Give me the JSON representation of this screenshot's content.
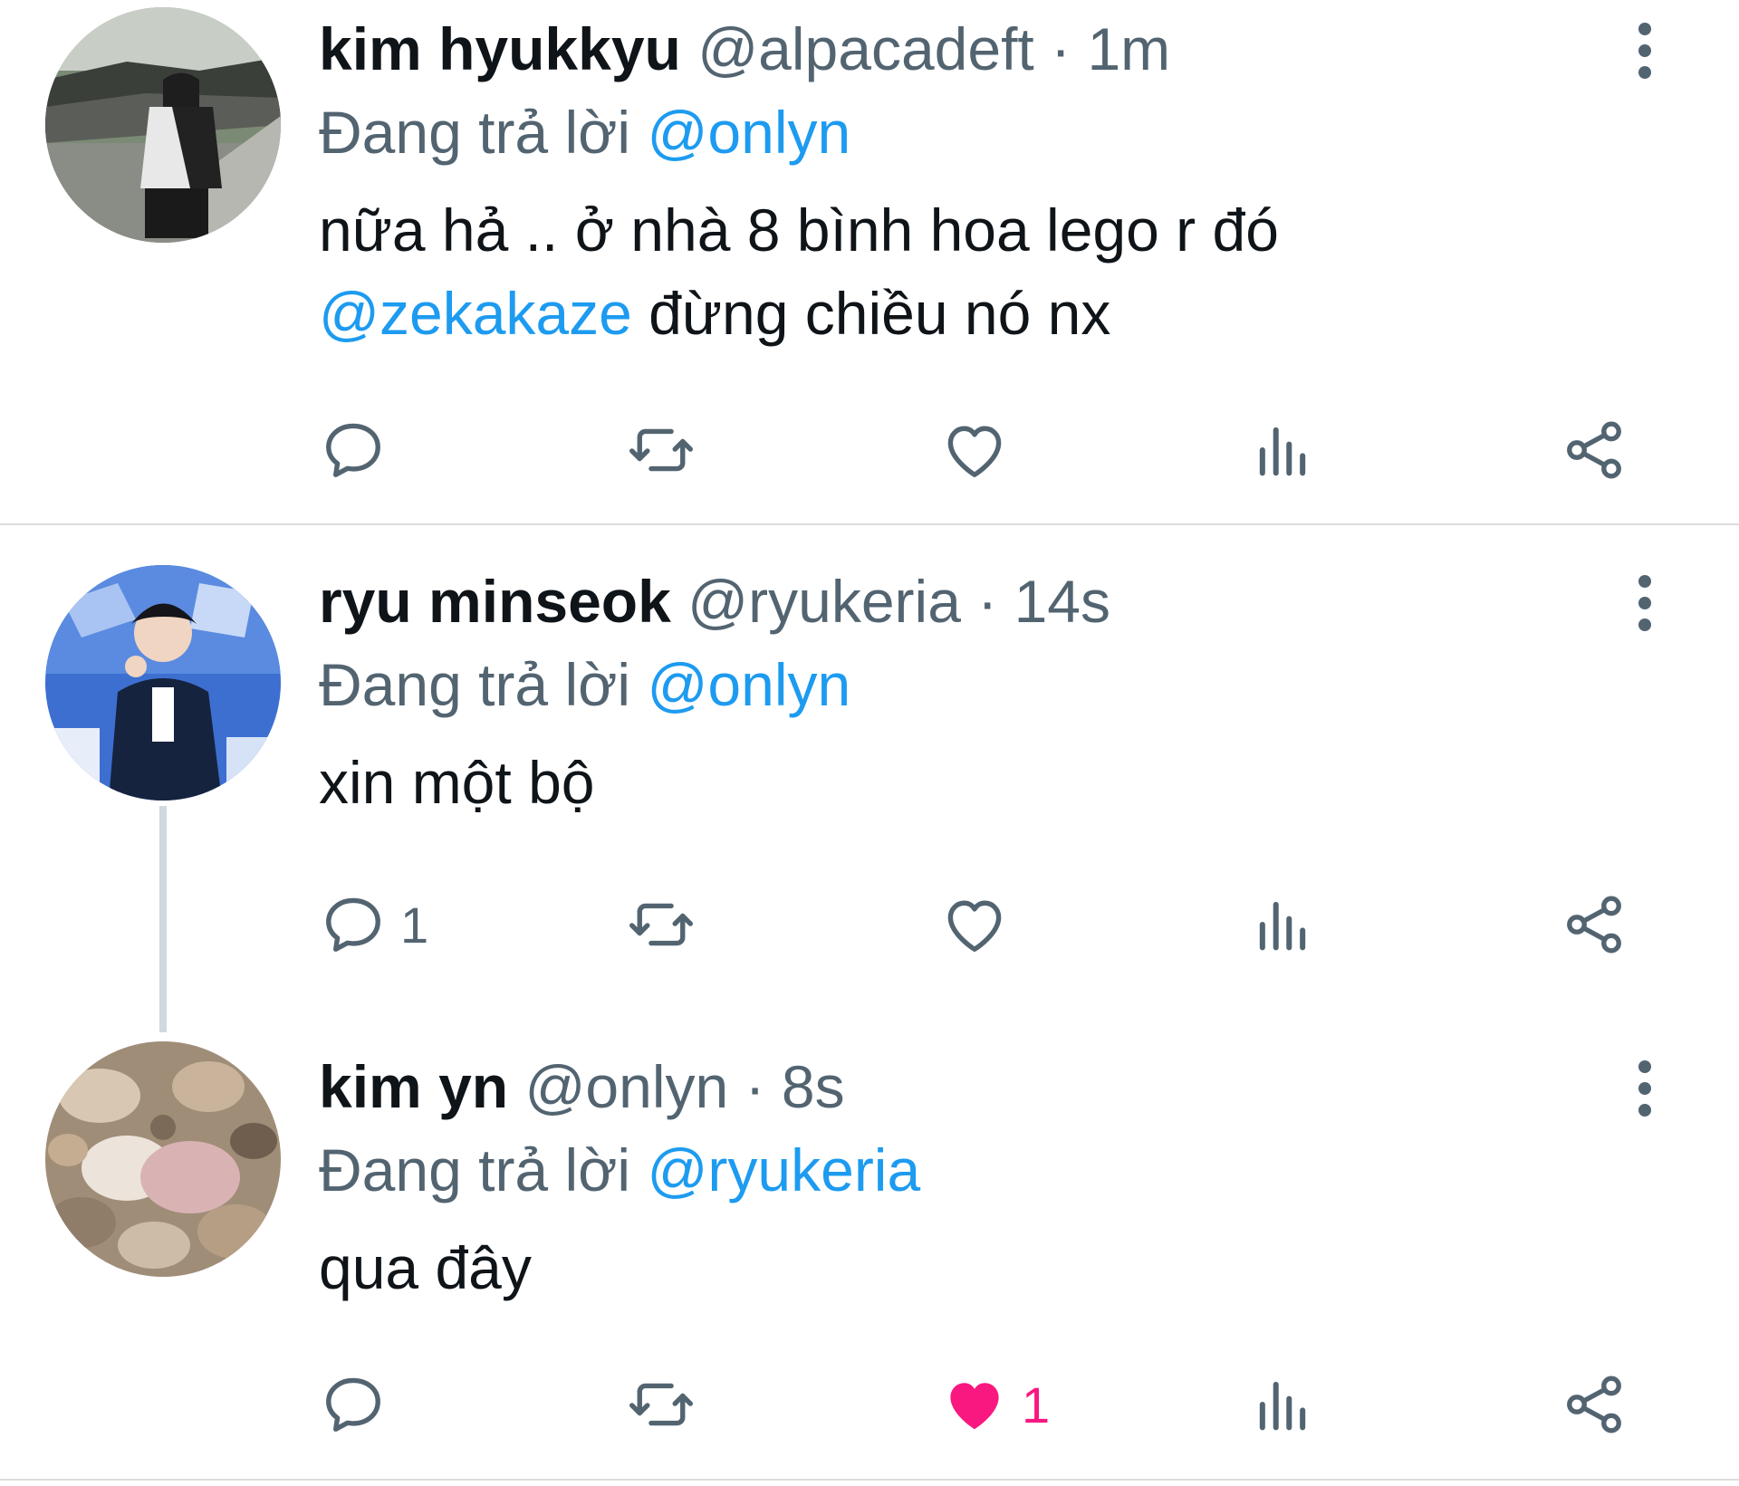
{
  "tweets": [
    {
      "name": "kim hyukkyu",
      "handle": "@alpacadeft",
      "sep": "·",
      "time": "1m",
      "reply_prefix": "Đang trả lời",
      "reply_to": "@onlyn",
      "text_line1": "nữa hả .. ở nhà 8 bình hoa lego r đó",
      "text_mention": "@zekakaze",
      "text_rest": " đừng chiều nó nx",
      "reply_count": "",
      "like_count": ""
    },
    {
      "name": "ryu minseok",
      "handle": "@ryukeria",
      "sep": "·",
      "time": "14s",
      "reply_prefix": "Đang trả lời",
      "reply_to": "@onlyn",
      "text": "xin một bộ",
      "reply_count": "1",
      "like_count": ""
    },
    {
      "name": "kim yn",
      "handle": "@onlyn",
      "sep": "·",
      "time": "8s",
      "reply_prefix": "Đang trả lời",
      "reply_to": "@ryukeria",
      "text": "qua đây",
      "reply_count": "",
      "like_count": "1",
      "liked": true
    }
  ],
  "icons": [
    "reply-icon",
    "retweet-icon",
    "like-icon",
    "views-icon",
    "share-icon",
    "more-icon"
  ],
  "colors": {
    "accent": "#1d9bf0",
    "muted": "#536471",
    "like": "#f91880",
    "text": "#0f1419"
  }
}
